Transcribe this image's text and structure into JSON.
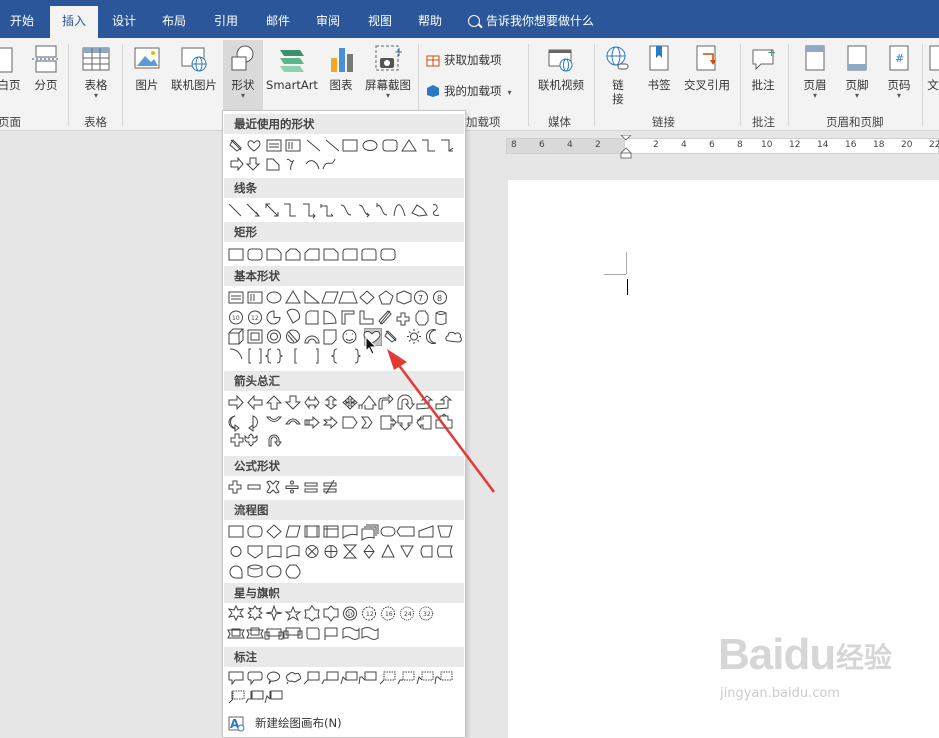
{
  "tabs": [
    "开始",
    "插入",
    "设计",
    "布局",
    "引用",
    "邮件",
    "审阅",
    "视图",
    "帮助"
  ],
  "active_tab": "插入",
  "tell_me": "告诉我你想要做什么",
  "ribbon": {
    "cut_page_label": "白页",
    "page_break_label": "分页",
    "group_pages": "页面",
    "table_label": "表格",
    "group_table": "表格",
    "picture_label": "图片",
    "online_picture_label": "联机图片",
    "shapes_label": "形状",
    "smartart_label": "SmartArt",
    "chart_label": "图表",
    "screenshot_label": "屏幕截图",
    "get_addins_label": "获取加载项",
    "my_addins_label": "我的加载项",
    "group_addins": "加载项",
    "online_video_label": "联机视频",
    "group_media": "媒体",
    "link_label_1": "链",
    "link_label_2": "接",
    "bookmark_label": "书签",
    "cross_ref_label": "交叉引用",
    "group_links": "链接",
    "comment_label": "批注",
    "group_comments": "批注",
    "header_label": "页眉",
    "footer_label": "页脚",
    "page_number_label": "页码",
    "group_header_footer": "页眉和页脚",
    "text_label_partial": "文"
  },
  "ruler_numbers": [
    "8",
    "6",
    "4",
    "2",
    "2",
    "2",
    "4",
    "6",
    "8",
    "10",
    "12",
    "14",
    "16",
    "18",
    "20",
    "22"
  ],
  "gallery": {
    "sections": [
      "最近使用的形状",
      "线条",
      "矩形",
      "基本形状",
      "箭头总汇",
      "公式形状",
      "流程图",
      "星与旗帜",
      "标注"
    ],
    "new_canvas": "新建绘图画布(N)"
  },
  "watermark": {
    "brand": "Baidu",
    "cn": "经验",
    "url": "jingyan.baidu.com"
  },
  "colors": {
    "tab_bar": "#2b579a",
    "ribbon_bg": "#f3f3f3",
    "arrow": "#e53935"
  }
}
